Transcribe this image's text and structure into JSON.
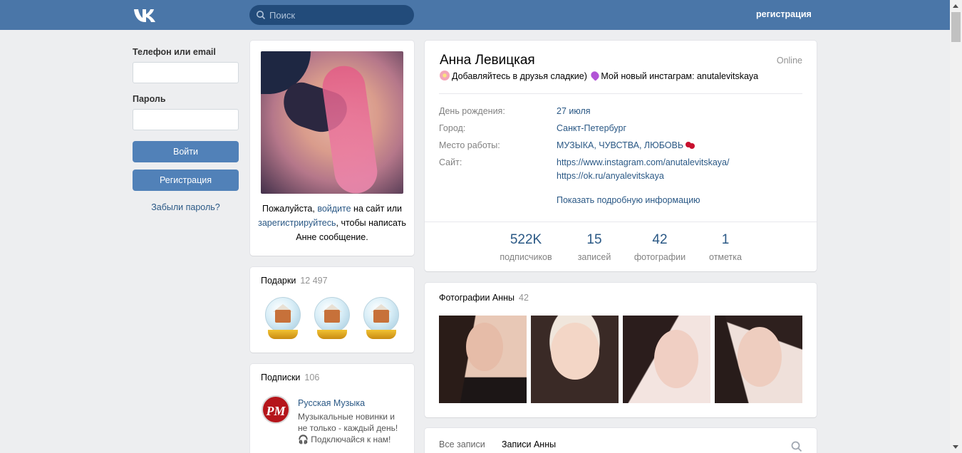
{
  "header": {
    "search_placeholder": "Поиск",
    "register_link": "регистрация",
    "accent_color": "#4a76a8"
  },
  "login": {
    "phone_label": "Телефон или email",
    "phone_value": "",
    "password_label": "Пароль",
    "password_value": "",
    "login_button": "Войти",
    "register_button": "Регистрация",
    "forgot_link": "Забыли пароль?"
  },
  "avatar_note": {
    "part1": "Пожалуйста, ",
    "login_link": "войдите",
    "part2": " на сайт или ",
    "register_link": "зарегистрируйтесь",
    "part3": ", чтобы написать Анне сообщение."
  },
  "gifts": {
    "title": "Подарки",
    "count": "12 497",
    "items": [
      "gingerbread-house-snow-globe",
      "gingerbread-house-snow-globe",
      "gingerbread-house-snow-globe"
    ]
  },
  "subscriptions": {
    "title": "Подписки",
    "count": "106",
    "item": {
      "avatar_text": "PM",
      "name": "Русская Музыка",
      "desc_line1": "Музыкальные новинки и",
      "desc_line2": "не только - каждый день!",
      "desc_line3": "Подключайся к нам!"
    }
  },
  "profile": {
    "name": "Анна Левицкая",
    "online": "Online",
    "status": "Добавляйтесь в друзья сладкие)",
    "status_tail": "Мой новый инстаграм: anutalevitskaya",
    "info": [
      {
        "key": "День рождения:",
        "value": "27 июля"
      },
      {
        "key": "Город:",
        "value": "Санкт-Петербург"
      },
      {
        "key": "Место работы:",
        "value": "МУЗЫКА, ЧУВСТВА, ЛЮБОВЬ"
      },
      {
        "key": "Сайт:",
        "value": "https://www.instagram.com/anutalevitskaya/",
        "value2": "https://ok.ru/anyalevitskaya"
      }
    ],
    "more_info": "Показать подробную информацию",
    "counters": [
      {
        "num": "522K",
        "label": "подписчиков"
      },
      {
        "num": "15",
        "label": "записей"
      },
      {
        "num": "42",
        "label": "фотографии"
      },
      {
        "num": "1",
        "label": "отметка"
      }
    ]
  },
  "photos": {
    "title": "Фотографии Анны",
    "count": "42"
  },
  "wall": {
    "tab_all": "Все записи",
    "tab_own": "Записи Анны"
  }
}
